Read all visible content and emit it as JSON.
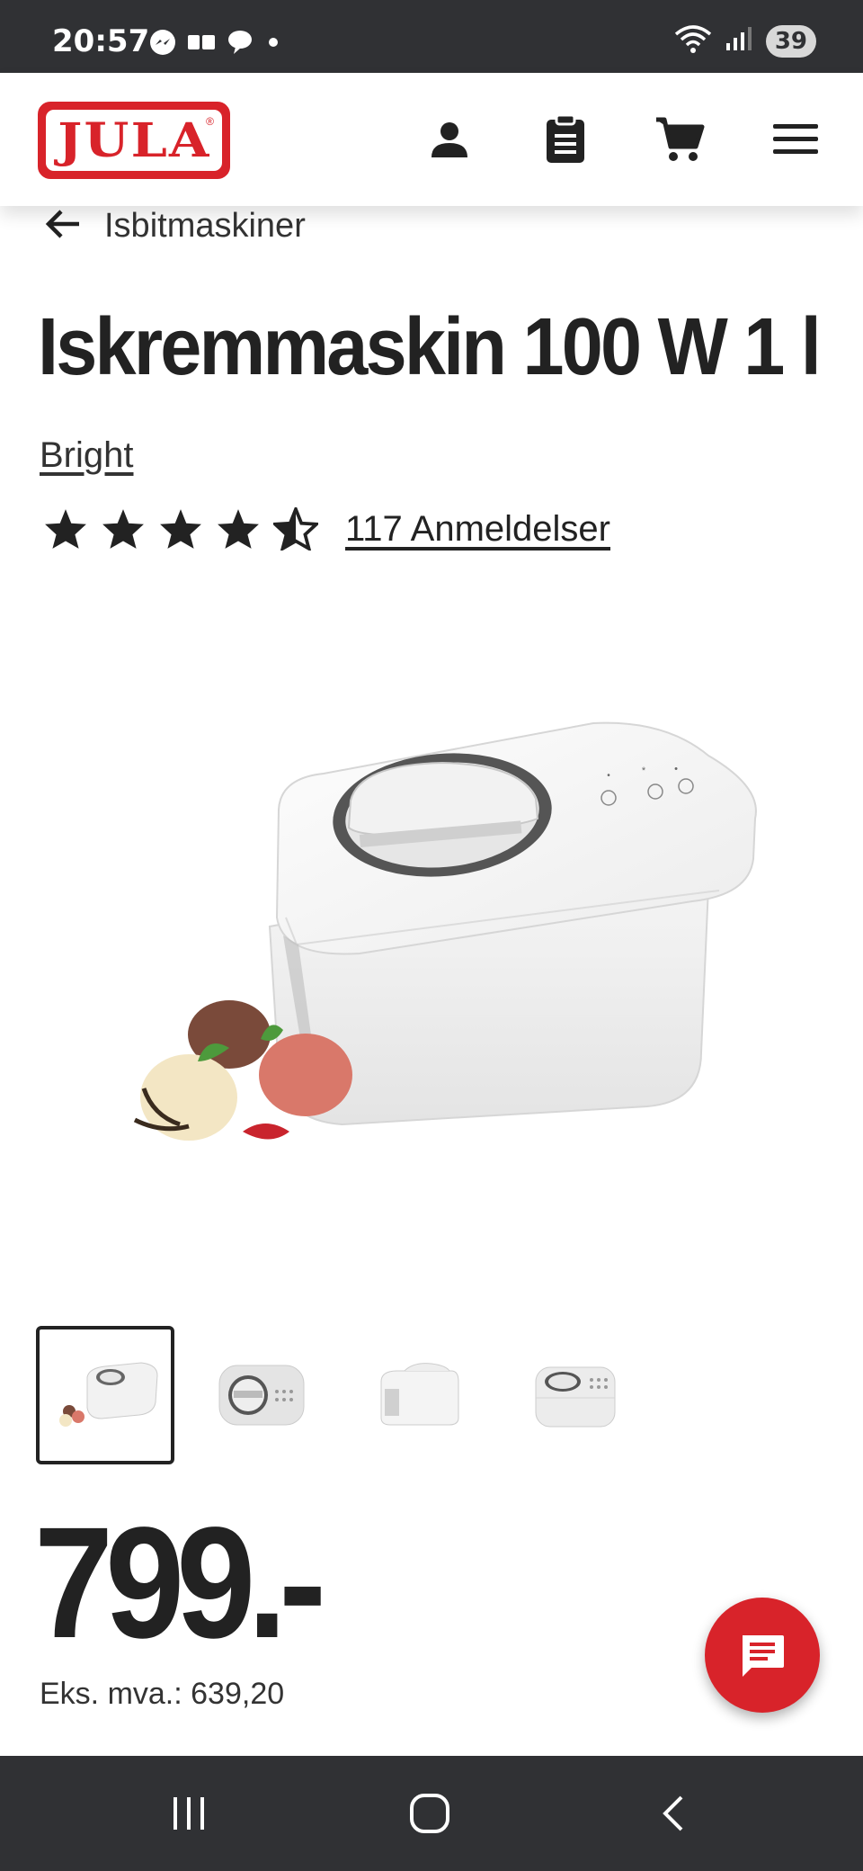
{
  "status_bar": {
    "time": "20:57",
    "battery": "39",
    "icons": [
      "messenger-icon",
      "media-icon",
      "chat-bubble-icon",
      "dot-icon",
      "wifi-icon",
      "signal-icon"
    ]
  },
  "header": {
    "logo_text": "JULA",
    "logo_mark": "®",
    "icons": [
      "account-icon",
      "clipboard-icon",
      "cart-icon",
      "menu-icon"
    ]
  },
  "breadcrumb": {
    "back_icon": "arrow-left-icon",
    "label": "Isbitmaskiner"
  },
  "product": {
    "title": "Iskremmaskin 100 W 1 l",
    "brand": "Bright",
    "rating": 4.5,
    "rating_max": 5,
    "reviews": "117 Anmeldelser",
    "price": "799.-",
    "ex_vat": "Eks. mva.: 639,20"
  },
  "thumbnails": {
    "count": 4,
    "selected_index": 0
  },
  "colors": {
    "brand_red": "#d8232a",
    "status_bar_bg": "#303134",
    "text_dark": "#222222"
  },
  "chat": {
    "icon": "chat-icon"
  },
  "nav_bar": {
    "buttons": [
      "recent-apps-icon",
      "home-icon",
      "back-icon"
    ]
  }
}
